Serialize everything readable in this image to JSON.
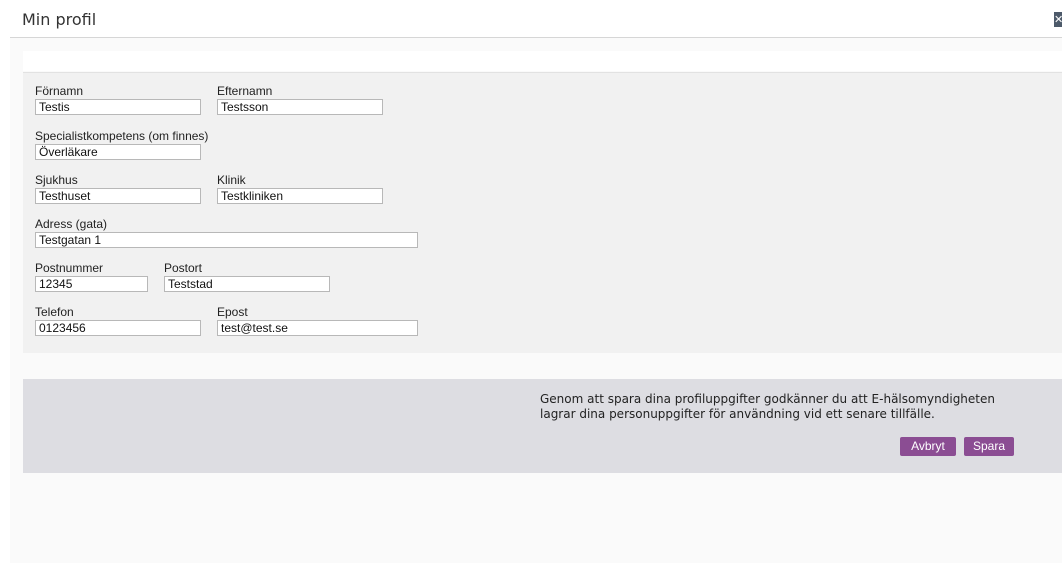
{
  "dialog": {
    "title": "Min profil",
    "close_icon": "close-icon"
  },
  "form": {
    "first_name": {
      "label": "Förnamn",
      "value": "Testis"
    },
    "last_name": {
      "label": "Efternamn",
      "value": "Testsson"
    },
    "specialty": {
      "label": "Specialistkompetens (om finnes)",
      "value": "Överläkare"
    },
    "hospital": {
      "label": "Sjukhus",
      "value": "Testhuset"
    },
    "clinic": {
      "label": "Klinik",
      "value": "Testkliniken"
    },
    "address": {
      "label": "Adress (gata)",
      "value": "Testgatan 1"
    },
    "postal_code": {
      "label": "Postnummer",
      "value": "12345"
    },
    "city": {
      "label": "Postort",
      "value": "Teststad"
    },
    "phone": {
      "label": "Telefon",
      "value": "0123456"
    },
    "email": {
      "label": "Epost",
      "value": "test@test.se"
    }
  },
  "consent": {
    "line1": "Genom att spara dina profiluppgifter godkänner du att E-hälsomyndigheten",
    "line2": "lagrar dina personuppgifter för användning vid ett senare tillfälle."
  },
  "buttons": {
    "cancel_label": "Avbryt",
    "save_label": "Spara"
  },
  "colors": {
    "button_purple": "#8b4d93",
    "consent_panel": "#dddde2",
    "form_panel": "#f1f1f1",
    "close_icon_bg": "#4d5a6a"
  }
}
